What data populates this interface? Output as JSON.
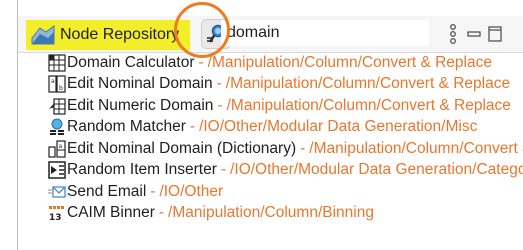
{
  "panel": {
    "tab_label": "Node Repository",
    "tab_icon": "node-repository-icon",
    "search_button_icon": "search-icon",
    "search_value": "domain",
    "highlight_color": "#f07a1e",
    "tab_color": "#f3ee2a",
    "path_color": "#e8772e",
    "separator": "-"
  },
  "results": [
    {
      "name": "Domain Calculator",
      "path": "/Manipulation/Column/Convert & Replace",
      "icon": "domain-calculator-icon"
    },
    {
      "name": "Edit Nominal Domain",
      "path": "/Manipulation/Column/Convert & Replace",
      "icon": "edit-nominal-domain-icon"
    },
    {
      "name": "Edit Numeric Domain",
      "path": "/Manipulation/Column/Convert & Replace",
      "icon": "edit-numeric-domain-icon"
    },
    {
      "name": "Random Matcher",
      "path": "/IO/Other/Modular Data Generation/Misc",
      "icon": "random-matcher-icon"
    },
    {
      "name": "Edit Nominal Domain (Dictionary)",
      "path": "/Manipulation/Column/Convert & Replace",
      "icon": "edit-nominal-domain-dictionary-icon"
    },
    {
      "name": "Random Item Inserter ",
      "path": "/IO/Other/Modular Data Generation/Categorical",
      "icon": "random-item-inserter-icon"
    },
    {
      "name": "Send Email",
      "path": "/IO/Other",
      "icon": "send-email-icon"
    },
    {
      "name": "CAIM Binner",
      "path": "/Manipulation/Column/Binning",
      "icon": "caim-binner-icon"
    }
  ]
}
